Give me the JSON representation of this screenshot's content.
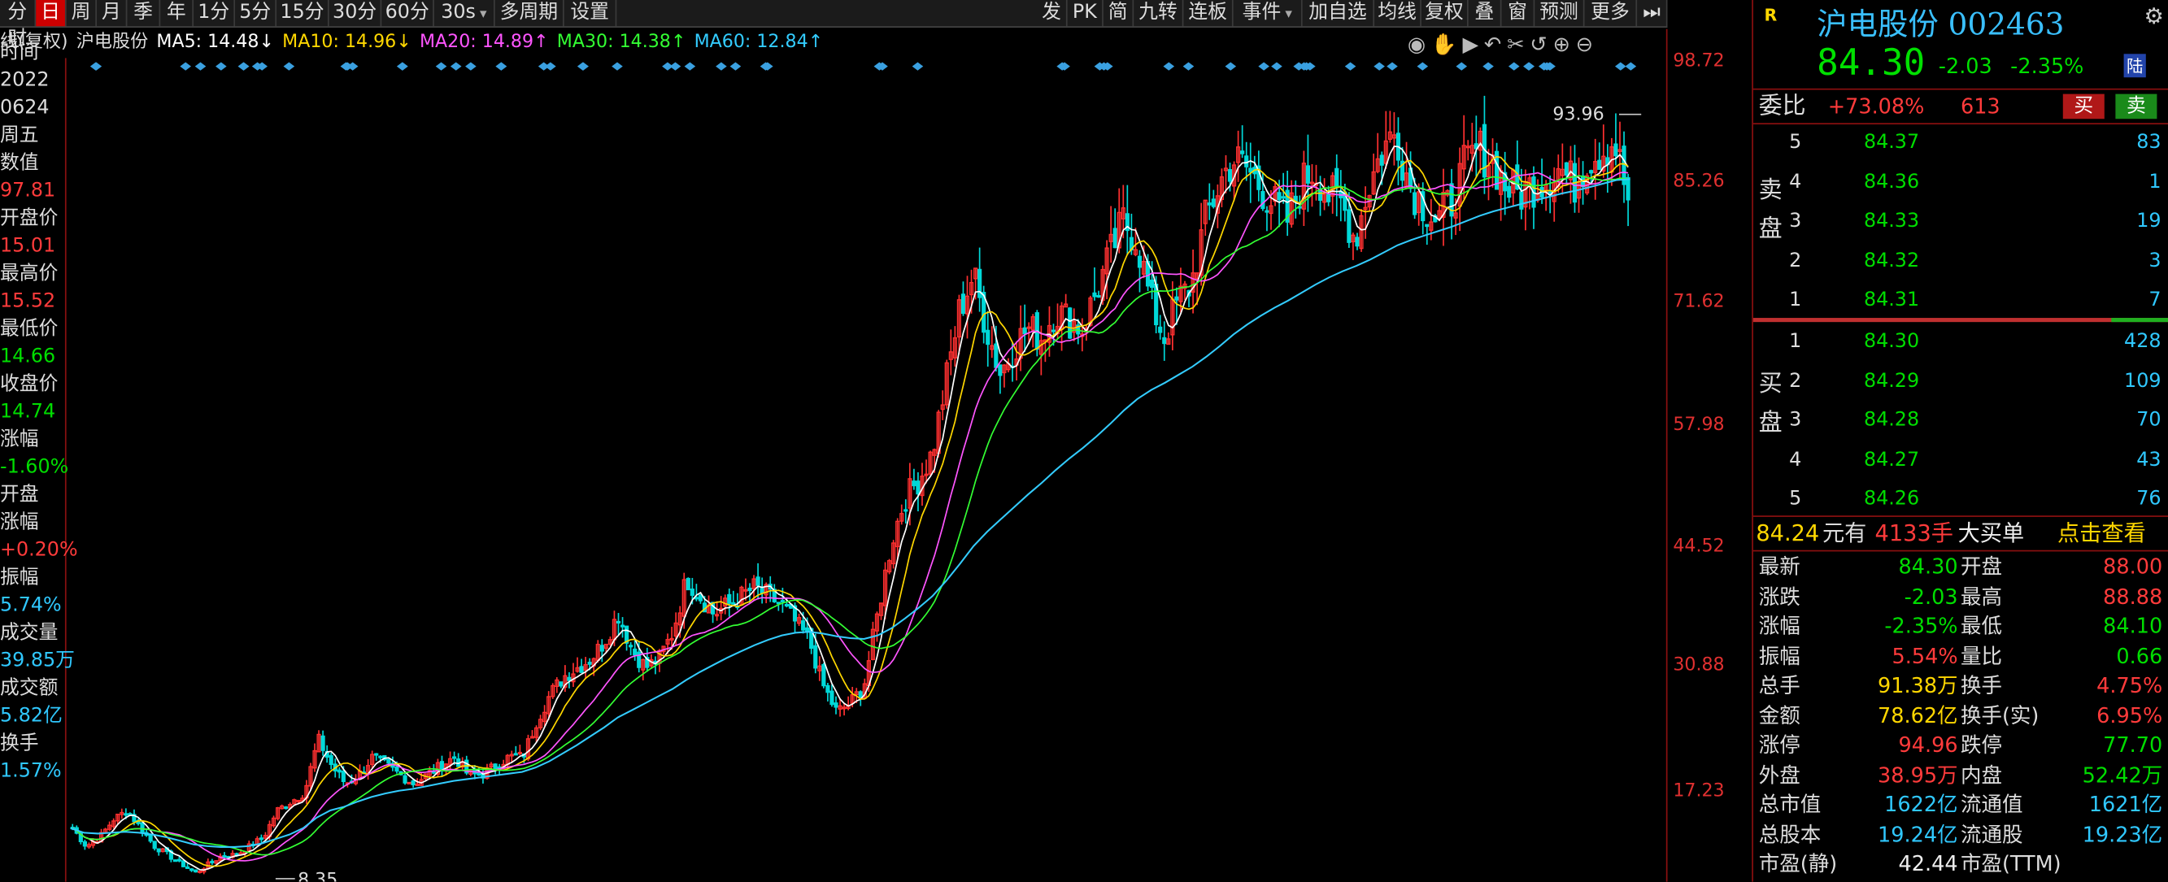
{
  "toolbar": {
    "left": [
      "分时",
      "日",
      "周",
      "月",
      "季",
      "年",
      "1分",
      "5分",
      "15分",
      "30分",
      "60分",
      "30s",
      "多周期",
      "设置"
    ],
    "active": "日",
    "right": [
      "发",
      "PK",
      "简",
      "九转",
      "连板",
      "事件",
      "加自选",
      "均线",
      "复权",
      "叠",
      "窗",
      "预测",
      "更多"
    ]
  },
  "legend": {
    "prefix": "线(复权)",
    "name": "沪电股份",
    "ma": [
      {
        "label": "MA5: 14.48↓",
        "color": "#ffffff"
      },
      {
        "label": "MA10: 14.96↓",
        "color": "#ffd700"
      },
      {
        "label": "MA20: 14.89↑",
        "color": "#ff55ff"
      },
      {
        "label": "MA30: 14.38↑",
        "color": "#33ff33"
      },
      {
        "label": "MA60: 12.84↑",
        "color": "#33ccff"
      }
    ]
  },
  "chart_icons": [
    "eye-icon",
    "hand-icon",
    "play-icon",
    "undo-icon",
    "scissors-icon",
    "reset-icon",
    "zoom-in-icon",
    "zoom-out-icon"
  ],
  "left_panel": [
    {
      "t": "时间",
      "c": "#dddddd"
    },
    {
      "t": "2022",
      "c": "#dddddd"
    },
    {
      "t": "0624",
      "c": "#dddddd"
    },
    {
      "t": "周五",
      "c": "#dddddd"
    },
    {
      "t": "数值",
      "c": "#dddddd"
    },
    {
      "t": "97.81",
      "c": "#ff3b3b"
    },
    {
      "t": "开盘价",
      "c": "#dddddd"
    },
    {
      "t": "15.01",
      "c": "#ff3b3b"
    },
    {
      "t": "最高价",
      "c": "#dddddd"
    },
    {
      "t": "15.52",
      "c": "#ff3b3b"
    },
    {
      "t": "最低价",
      "c": "#dddddd"
    },
    {
      "t": "14.66",
      "c": "#00dd00"
    },
    {
      "t": "收盘价",
      "c": "#dddddd"
    },
    {
      "t": "14.74",
      "c": "#00dd00"
    },
    {
      "t": "涨幅",
      "c": "#dddddd"
    },
    {
      "t": "-1.60%",
      "c": "#00dd00"
    },
    {
      "t": "开盘",
      "c": "#dddddd"
    },
    {
      "t": "涨幅",
      "c": "#dddddd"
    },
    {
      "t": "+0.20%",
      "c": "#ff3b3b"
    },
    {
      "t": "振幅",
      "c": "#dddddd"
    },
    {
      "t": "5.74%",
      "c": "#30c8ff"
    },
    {
      "t": "成交量",
      "c": "#dddddd"
    },
    {
      "t": "39.85万",
      "c": "#30c8ff"
    },
    {
      "t": "成交额",
      "c": "#dddddd"
    },
    {
      "t": "5.82亿",
      "c": "#30c8ff"
    },
    {
      "t": "换手",
      "c": "#dddddd"
    },
    {
      "t": "1.57%",
      "c": "#30c8ff"
    }
  ],
  "axis": [
    "98.72",
    "85.26",
    "71.62",
    "57.98",
    "44.52",
    "30.88",
    "17.23"
  ],
  "chart_labels": {
    "high": "93.96",
    "low": "8.35"
  },
  "chart_data": {
    "type": "candlestick",
    "ylim": [
      8.0,
      98.72
    ],
    "annotations": {
      "high": 93.96,
      "low": 8.35
    },
    "x": [
      0,
      25,
      50,
      75,
      100,
      125,
      150,
      175,
      200,
      225,
      250,
      275,
      300,
      325,
      350,
      375,
      400,
      425,
      450,
      475,
      500,
      525,
      550,
      575,
      600,
      625,
      650,
      675,
      700,
      725,
      750,
      775,
      800,
      825,
      850,
      875,
      900,
      925,
      950,
      975,
      1000,
      1025,
      1050,
      1075,
      1100,
      1125,
      1150,
      1175,
      1200,
      1225,
      1250,
      1275,
      1300,
      1325,
      1350,
      1375,
      1400,
      1425,
      1450,
      1475,
      1500,
      1525,
      1550,
      1575,
      1600,
      1625,
      1650,
      1675,
      1700,
      1725,
      1750,
      1775,
      1800,
      1825,
      1850,
      1875,
      1900,
      1925,
      1950,
      1975,
      2000,
      2025,
      2050,
      2075,
      2100,
      2125,
      2150,
      2175,
      2200,
      2225,
      2250,
      2275,
      2300,
      2325,
      2350,
      2375,
      2400,
      2425,
      2450,
      2475,
      2500,
      2525,
      2550,
      2575,
      2600,
      2625,
      2650,
      2675,
      2700,
      2725,
      2750,
      2775,
      2800,
      2825,
      2850
    ],
    "close": [
      14,
      12,
      13,
      15,
      16,
      14,
      12,
      11,
      10,
      9,
      10,
      11,
      11,
      12,
      13,
      16,
      17,
      18,
      24,
      21,
      19,
      20,
      22,
      21,
      20,
      19,
      20,
      21,
      22,
      20,
      20,
      21,
      22,
      22,
      26,
      29,
      31,
      32,
      33,
      35,
      38,
      34,
      32,
      33,
      36,
      42,
      40,
      38,
      39,
      40,
      41,
      40,
      39,
      37,
      35,
      30,
      27,
      28,
      30,
      38,
      46,
      51,
      53,
      56,
      64,
      72,
      76,
      70,
      65,
      68,
      70,
      69,
      72,
      71,
      70,
      74,
      78,
      82,
      80,
      73,
      69,
      73,
      75,
      82,
      86,
      89,
      88,
      86,
      84,
      82,
      86,
      88,
      85,
      84,
      80,
      86,
      90,
      92,
      86,
      84,
      82,
      84,
      88,
      90,
      89,
      86,
      85,
      86,
      87,
      88,
      86,
      89,
      90,
      91,
      84.3
    ],
    "ma60": [
      14,
      13.5,
      13.4,
      13.5,
      13.6,
      13.5,
      13.3,
      13,
      12.6,
      12.2,
      12,
      11.9,
      11.9,
      12,
      12.3,
      12.8,
      13.3,
      14,
      15.2,
      16,
      16.4,
      17,
      17.5,
      17.9,
      18.2,
      18.4,
      18.7,
      19,
      19.3,
      19.5,
      19.7,
      19.9,
      20.1,
      20.3,
      20.8,
      21.5,
      22.4,
      23.3,
      24.3,
      25.3,
      26.4,
      27.2,
      28,
      28.8,
      29.6,
      30.6,
      31.5,
      32.3,
      33.1,
      33.8,
      34.5,
      35.1,
      35.6,
      35.9,
      36,
      35.8,
      35.5,
      35.3,
      35.2,
      35.6,
      36.4,
      37.5,
      38.7,
      40,
      41.7,
      43.6,
      45.6,
      47.2,
      48.6,
      50,
      51.4,
      52.7,
      54.1,
      55.4,
      56.6,
      57.9,
      59.3,
      60.8,
      62.1,
      63.1,
      63.9,
      64.8,
      65.7,
      66.8,
      68,
      69.3,
      70.4,
      71.4,
      72.3,
      73.1,
      74,
      74.9,
      75.7,
      76.4,
      77,
      77.7,
      78.5,
      79.3,
      79.9,
      80.4,
      80.9,
      81.4,
      82,
      82.6,
      83.1,
      83.5,
      83.9,
      84.3,
      84.7,
      85.1,
      85.4,
      85.8,
      86.2,
      86.6,
      86.7
    ]
  },
  "right": {
    "badge": "R",
    "title": "沪电股份 002463",
    "price": "84.30",
    "change": "-2.03",
    "change_pct": "-2.35%",
    "market_badge": "陆",
    "webi_label": "委比",
    "webi_value": "+73.08%",
    "webi_diff": "613",
    "buy_btn": "买",
    "sell_btn": "卖",
    "sell_label": [
      "卖",
      "盘"
    ],
    "buy_label": [
      "买",
      "盘"
    ],
    "asks": [
      {
        "lvl": "5",
        "price": "84.37",
        "vol": "83"
      },
      {
        "lvl": "4",
        "price": "84.36",
        "vol": "1"
      },
      {
        "lvl": "3",
        "price": "84.33",
        "vol": "19"
      },
      {
        "lvl": "2",
        "price": "84.32",
        "vol": "3"
      },
      {
        "lvl": "1",
        "price": "84.31",
        "vol": "7"
      }
    ],
    "bids": [
      {
        "lvl": "1",
        "price": "84.30",
        "vol": "428"
      },
      {
        "lvl": "2",
        "price": "84.29",
        "vol": "109"
      },
      {
        "lvl": "3",
        "price": "84.28",
        "vol": "70"
      },
      {
        "lvl": "4",
        "price": "84.27",
        "vol": "43"
      },
      {
        "lvl": "5",
        "price": "84.26",
        "vol": "76"
      }
    ],
    "big_order": {
      "price": "84.24",
      "p1": "元有",
      "vol": "4133手",
      "p2": "大买单",
      "action": "点击查看"
    },
    "stats": [
      {
        "l": "最新",
        "v": "84.30",
        "vc": "green",
        "l2": "开盘",
        "v2": "88.00",
        "vc2": "red"
      },
      {
        "l": "涨跌",
        "v": "-2.03",
        "vc": "green",
        "l2": "最高",
        "v2": "88.88",
        "vc2": "red"
      },
      {
        "l": "涨幅",
        "v": "-2.35%",
        "vc": "green",
        "l2": "最低",
        "v2": "84.10",
        "vc2": "green"
      },
      {
        "l": "振幅",
        "v": "5.54%",
        "vc": "red",
        "l2": "量比",
        "v2": "0.66",
        "vc2": "green"
      },
      {
        "l": "总手",
        "v": "91.38万",
        "vc": "yellow",
        "l2": "换手",
        "v2": "4.75%",
        "vc2": "red"
      },
      {
        "l": "金额",
        "v": "78.62亿",
        "vc": "yellow",
        "l2": "换手(实)",
        "v2": "6.95%",
        "vc2": "red"
      },
      {
        "l": "涨停",
        "v": "94.96",
        "vc": "red",
        "l2": "跌停",
        "v2": "77.70",
        "vc2": "green"
      },
      {
        "l": "外盘",
        "v": "38.95万",
        "vc": "red",
        "l2": "内盘",
        "v2": "52.42万",
        "vc2": "green"
      },
      {
        "l": "总市值",
        "v": "1622亿",
        "vc": "cyan",
        "l2": "流通值",
        "v2": "1621亿",
        "vc2": "cyan"
      },
      {
        "l": "总股本",
        "v": "19.24亿",
        "vc": "cyan",
        "l2": "流通股",
        "v2": "19.23亿",
        "vc2": "cyan"
      },
      {
        "l": "市盈(静)",
        "v": "42.44",
        "vc": "white",
        "l2": "市盈(TTM)",
        "v2": "",
        "vc2": "white"
      }
    ]
  }
}
